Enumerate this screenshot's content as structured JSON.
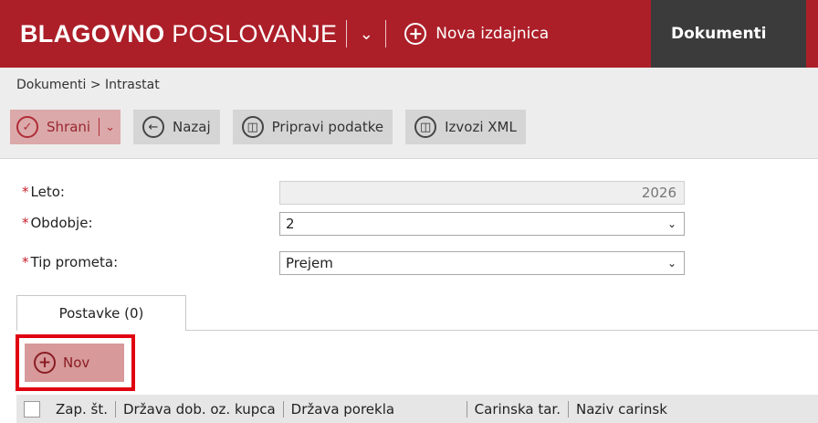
{
  "topbar": {
    "brand_bold": "BLAGOVNO",
    "brand_light": "POSLOVANJE",
    "menu_chevron": "chevron-down-icon",
    "new_issuer_label": "Nova izdajnica",
    "active_tab": "Dokumenti"
  },
  "breadcrumb": {
    "text": "Dokumenti > Intrastat"
  },
  "toolbar": {
    "save_label": "Shrani",
    "back_label": "Nazaj",
    "prepare_label": "Pripravi podatke",
    "export_label": "Izvozi XML"
  },
  "form": {
    "year": {
      "label": "Leto:",
      "value": "2026"
    },
    "period": {
      "label": "Obdobje:",
      "value": "2"
    },
    "traffic_type": {
      "label": "Tip prometa:",
      "value": "Prejem"
    }
  },
  "tabs": {
    "items_tab": "Postavke (0)"
  },
  "items": {
    "new_label": "Nov"
  },
  "grid": {
    "columns": [
      "Zap. št.",
      "Država dob. oz. kupca",
      "Država porekla",
      "Carinska tar.",
      "Naziv carinsk"
    ]
  },
  "colors": {
    "brand": "#ac1f29",
    "active_tab": "#3b3b3b",
    "highlight": "#e0000f"
  }
}
